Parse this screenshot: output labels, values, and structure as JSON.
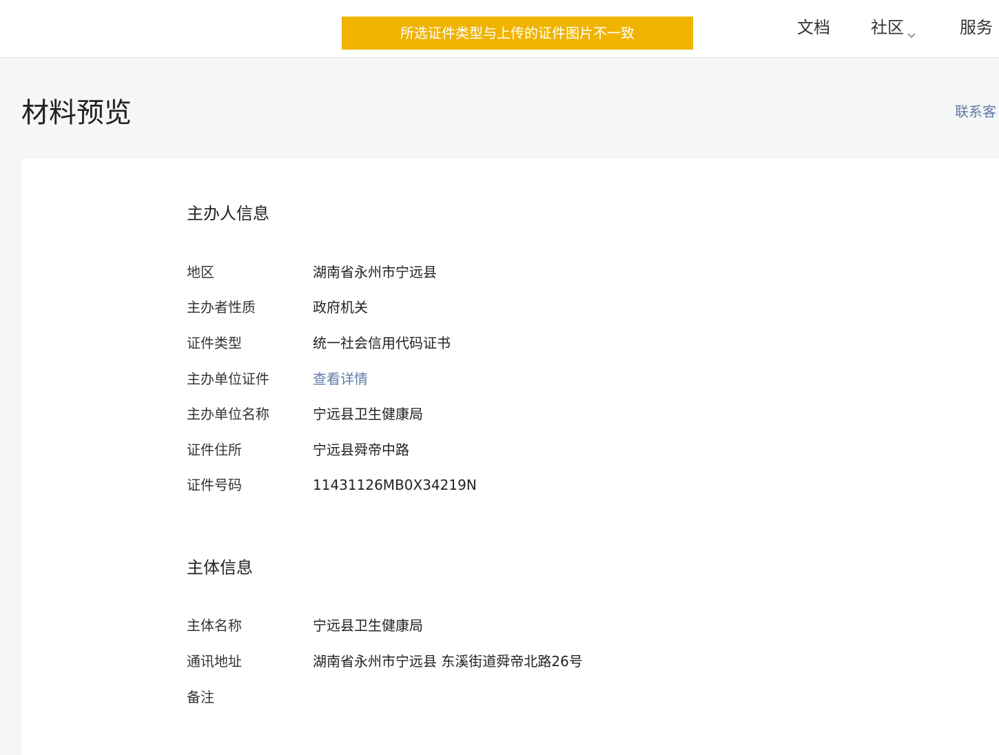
{
  "header": {
    "alert": "所选证件类型与上传的证件图片不一致",
    "nav": {
      "docs": "文档",
      "community": "社区",
      "services": "服务"
    }
  },
  "page": {
    "title": "材料预览",
    "contact": "联系客"
  },
  "sponsor_section": {
    "title": "主办人信息",
    "rows": [
      {
        "label": "地区",
        "value": "湖南省永州市宁远县"
      },
      {
        "label": "主办者性质",
        "value": "政府机关"
      },
      {
        "label": "证件类型",
        "value": "统一社会信用代码证书"
      },
      {
        "label": "主办单位证件",
        "value": "查看详情"
      },
      {
        "label": "主办单位名称",
        "value": "宁远县卫生健康局"
      },
      {
        "label": "证件住所",
        "value": "宁远县舜帝中路"
      },
      {
        "label": "证件号码",
        "value": "11431126MB0X34219N"
      }
    ]
  },
  "entity_section": {
    "title": "主体信息",
    "rows": [
      {
        "label": "主体名称",
        "value": "宁远县卫生健康局"
      },
      {
        "label": "通讯地址",
        "value": "湖南省永州市宁远县 东溪街道舜帝北路26号"
      },
      {
        "label": "备注",
        "value": ""
      }
    ]
  },
  "colors": {
    "alert_bg": "#f0b400",
    "link": "#5d7ba6",
    "page_bg": "#f5f6f7"
  }
}
